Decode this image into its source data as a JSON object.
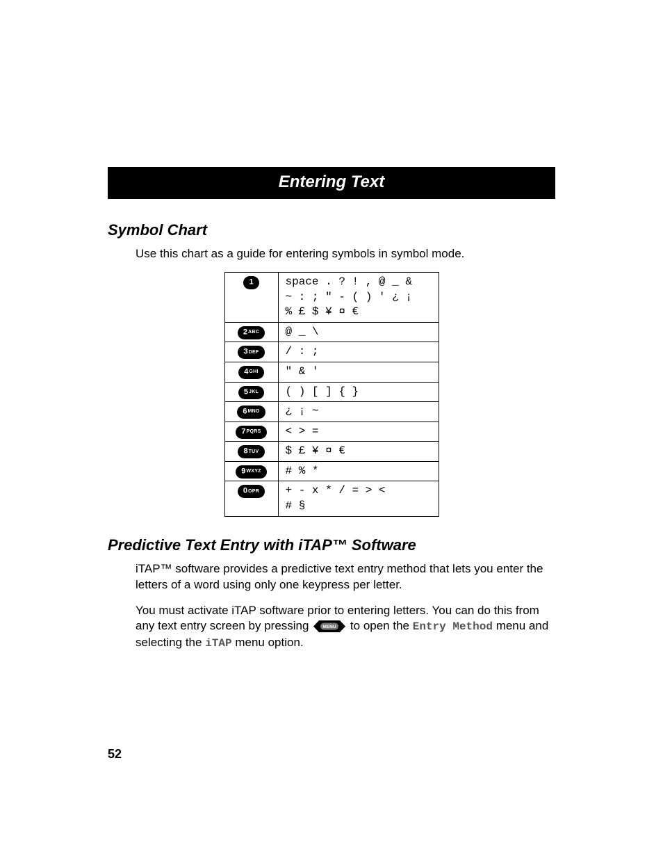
{
  "section_title": "Entering Text",
  "symbol_chart": {
    "heading": "Symbol Chart",
    "intro": "Use this chart as a guide for entering symbols in symbol mode.",
    "rows": [
      {
        "key_main": "1",
        "key_sub": "",
        "symbols": "space . ? ! , @ _ &\n~ : ; \" - ( ) ' ¿ ¡\n% £ $ ¥ ¤ €"
      },
      {
        "key_main": "2",
        "key_sub": "ABC",
        "symbols": "@ _ \\"
      },
      {
        "key_main": "3",
        "key_sub": "DEF",
        "symbols": "/ : ;"
      },
      {
        "key_main": "4",
        "key_sub": "GHI",
        "symbols": "\" & '"
      },
      {
        "key_main": "5",
        "key_sub": "JKL",
        "symbols": "( ) [ ] { }"
      },
      {
        "key_main": "6",
        "key_sub": "MNO",
        "symbols": "¿ ¡ ~"
      },
      {
        "key_main": "7",
        "key_sub": "PQRS",
        "symbols": "< > ="
      },
      {
        "key_main": "8",
        "key_sub": "TUV",
        "symbols": "$ £ ¥ ¤ €"
      },
      {
        "key_main": "9",
        "key_sub": "WXYZ",
        "symbols": "# % *"
      },
      {
        "key_main": "0",
        "key_sub": "OPR",
        "symbols": "+ - x * / = > <\n# §"
      }
    ]
  },
  "predictive": {
    "heading": "Predictive Text Entry with iTAP™ Software",
    "p1": "iTAP™ software provides a predictive text entry method that lets you enter the letters of a word using only one keypress per letter.",
    "p2_a": "You must activate iTAP software prior to entering letters. You can do this from any text entry screen by pressing ",
    "p2_b": " to open the ",
    "p2_c": " menu and selecting the ",
    "p2_d": " menu option.",
    "menu_key_label": "MENU",
    "ui_entry_method": "Entry Method",
    "ui_itap": "iTAP"
  },
  "page_number": "52"
}
